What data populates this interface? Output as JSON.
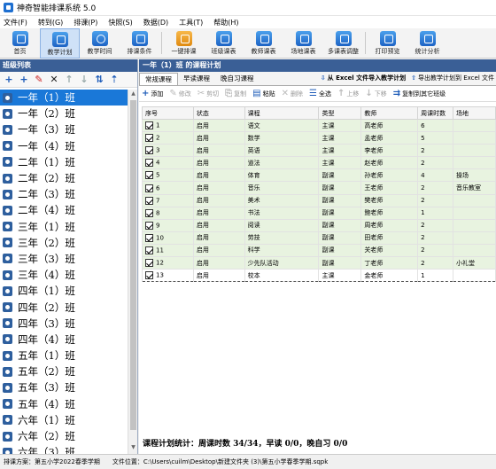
{
  "window": {
    "title": "神奇智能排课系统 5.0"
  },
  "menu": [
    "文件(F)",
    "转到(G)",
    "排课(P)",
    "快照(S)",
    "数据(D)",
    "工具(T)",
    "帮助(H)"
  ],
  "toolbar": [
    {
      "label": "首页",
      "icon": "home-icon"
    },
    {
      "label": "教学计划",
      "icon": "clipboard-icon",
      "active": true
    },
    {
      "label": "教学时间",
      "icon": "clock-icon"
    },
    {
      "label": "排课条件",
      "icon": "people-icon"
    },
    {
      "label": "一键排课",
      "icon": "hand-icon"
    },
    {
      "label": "班级课表",
      "icon": "grid-icon"
    },
    {
      "label": "教师课表",
      "icon": "calendar-icon"
    },
    {
      "label": "场地课表",
      "icon": "building-icon"
    },
    {
      "label": "多课表调整",
      "icon": "adjust-icon"
    },
    {
      "label": "打印预览",
      "icon": "printer-icon"
    },
    {
      "label": "统计分析",
      "icon": "bar-chart-icon"
    }
  ],
  "left": {
    "header": "班级列表",
    "tool_icons": [
      "add-icon",
      "add-child-icon",
      "edit-icon",
      "delete-icon",
      "arrow-up-icon",
      "arrow-down-icon",
      "sort-icon",
      "move-top-icon"
    ],
    "classes": [
      "一年（1）班",
      "一年（2）班",
      "一年（3）班",
      "一年（4）班",
      "二年（1）班",
      "二年（2）班",
      "二年（3）班",
      "二年（4）班",
      "三年（1）班",
      "三年（2）班",
      "三年（3）班",
      "三年（4）班",
      "四年（1）班",
      "四年（2）班",
      "四年（3）班",
      "四年（4）班",
      "五年（1）班",
      "五年（2）班",
      "五年（3）班",
      "五年（4）班",
      "六年（1）班",
      "六年（2）班",
      "六年（3）班"
    ]
  },
  "right": {
    "header": "一年（1）班 的课程计划",
    "tabs": [
      "常规课程",
      "早读课程",
      "晚自习课程"
    ],
    "import_label": "从 Excel 文件导入教学计划",
    "export_label": "导出教学计划到 Excel 文件",
    "edit_tools": [
      {
        "label": "添加",
        "enabled": true
      },
      {
        "label": "修改",
        "enabled": false
      },
      {
        "label": "剪切",
        "enabled": false
      },
      {
        "label": "复制",
        "enabled": false
      },
      {
        "label": "粘贴",
        "enabled": true
      },
      {
        "label": "删除",
        "enabled": false
      },
      {
        "label": "全选",
        "enabled": true
      },
      {
        "label": "上移",
        "enabled": false
      },
      {
        "label": "下移",
        "enabled": false
      },
      {
        "label": "复制到其它班级",
        "enabled": true
      }
    ],
    "columns": [
      "序号",
      "状态",
      "课程",
      "类型",
      "教师",
      "周课时数",
      "场地"
    ],
    "rows": [
      [
        "1",
        "启用",
        "语文",
        "主课",
        "高老师",
        "6",
        ""
      ],
      [
        "2",
        "启用",
        "数学",
        "主课",
        "孟老师",
        "5",
        ""
      ],
      [
        "3",
        "启用",
        "英语",
        "主课",
        "李老师",
        "2",
        ""
      ],
      [
        "4",
        "启用",
        "道法",
        "主课",
        "赵老师",
        "2",
        ""
      ],
      [
        "5",
        "启用",
        "体育",
        "副课",
        "孙老师",
        "4",
        "操场"
      ],
      [
        "6",
        "启用",
        "音乐",
        "副课",
        "王老师",
        "2",
        "音乐教室"
      ],
      [
        "7",
        "启用",
        "美术",
        "副课",
        "樊老师",
        "2",
        ""
      ],
      [
        "8",
        "启用",
        "书法",
        "副课",
        "鲍老师",
        "1",
        ""
      ],
      [
        "9",
        "启用",
        "阅读",
        "副课",
        "周老师",
        "2",
        ""
      ],
      [
        "10",
        "启用",
        "劳技",
        "副课",
        "田老师",
        "2",
        ""
      ],
      [
        "11",
        "启用",
        "科学",
        "副课",
        "关老师",
        "2",
        ""
      ],
      [
        "12",
        "启用",
        "少先队活动",
        "副课",
        "丁老师",
        "2",
        "小礼堂"
      ],
      [
        "13",
        "启用",
        "校本",
        "主课",
        "金老师",
        "1",
        ""
      ]
    ],
    "summary": "课程计划统计：周课时数 34/34，早读 0/0，晚自习 0/0"
  },
  "status": {
    "plan_label": "排课方案：第五小学2022春季学期",
    "file_label": "文件位置：C:\\Users\\cuilm\\Desktop\\新建文件夹 (3)\\第五小学春季学期.sqpk"
  }
}
